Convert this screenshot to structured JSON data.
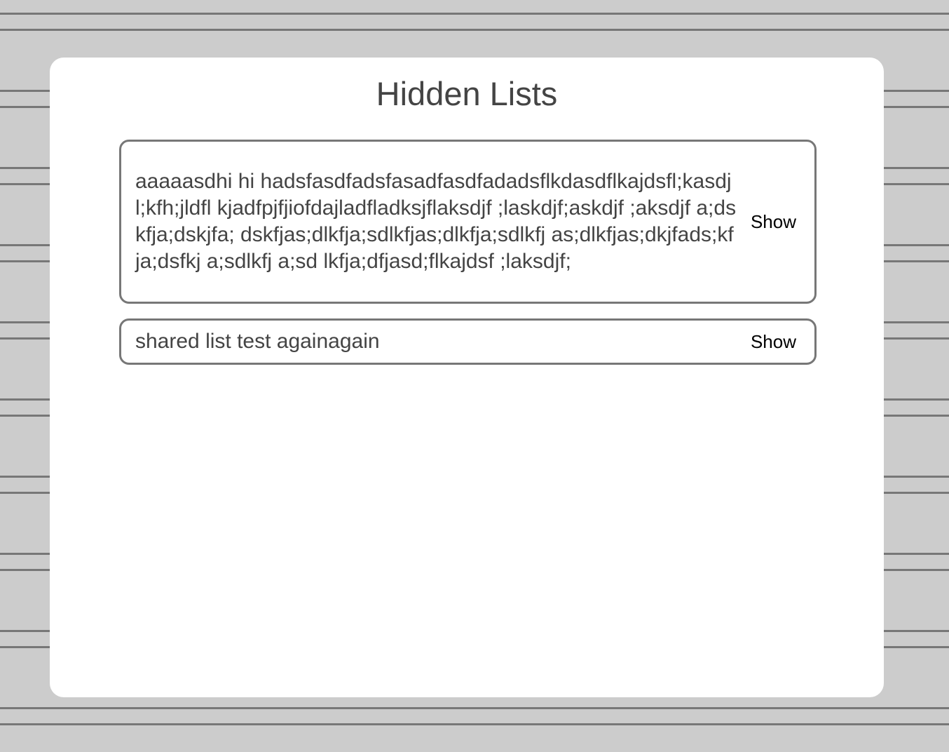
{
  "page": {
    "title": "Hidden Lists"
  },
  "lists": [
    {
      "name": "aaaaasdhi hi hadsfasdfadsfasadfasdfadadsflkdasdflkajdsfl;kasdjl;kfh;jldfl kjadfpjfjiofdajladfladksjflaksdjf ;laskdjf;askdjf ;aksdjf a;dskfja;dskjfa; dskfjas;dlkfja;sdlkfjas;dlkfja;sdlkfj as;dlkfjas;dkjfads;kfja;dsfkj a;sdlkfj a;sd lkfja;dfjasd;flkajdsf ;laksdjf;",
      "action_label": "Show"
    },
    {
      "name": "shared list test againagain",
      "action_label": "Show"
    }
  ],
  "colors": {
    "background": "#cccccc",
    "panel": "#ffffff",
    "border": "#777777",
    "text": "#444444"
  }
}
